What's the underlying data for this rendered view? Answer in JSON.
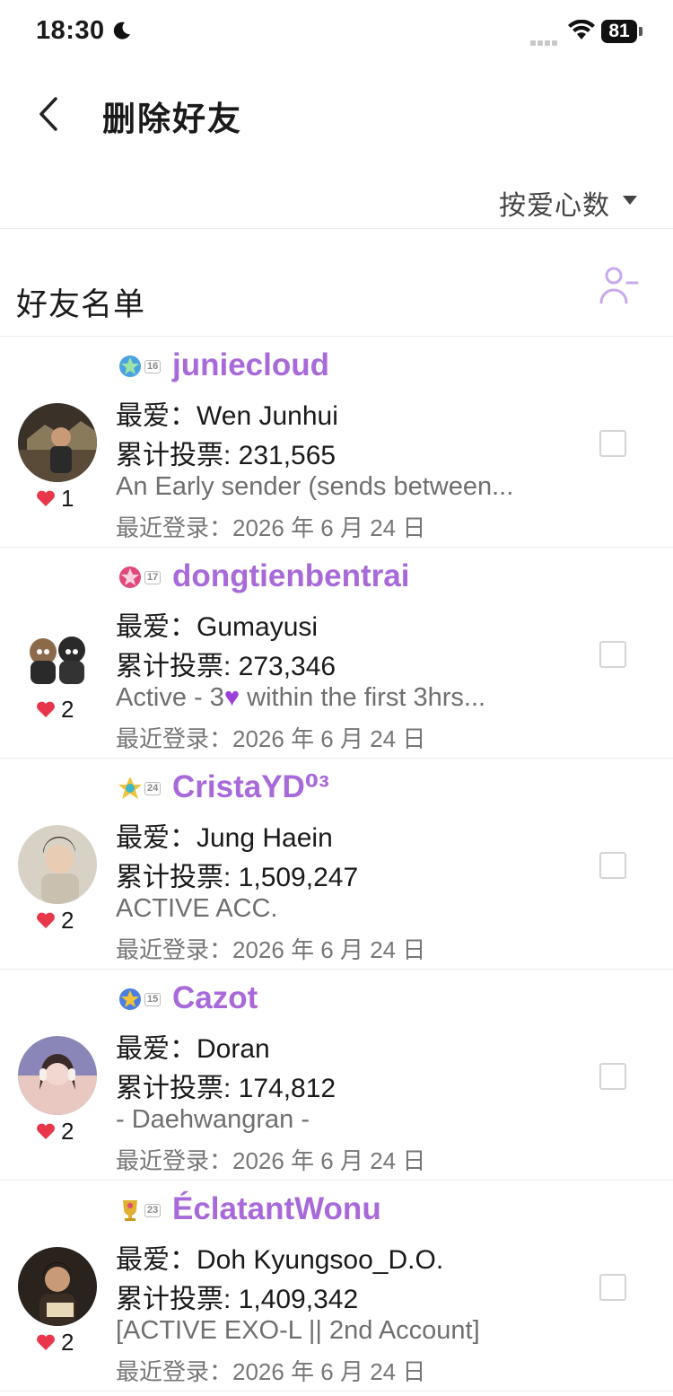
{
  "status_bar": {
    "time": "18:30",
    "battery": "81"
  },
  "nav": {
    "title": "删除好友"
  },
  "sort": {
    "label": "按爱心数"
  },
  "list": {
    "title": "好友名单"
  },
  "friends": [
    {
      "username": "juniecloud",
      "badge_level": "16",
      "badge_color": "#4aa3e0",
      "favorite": "最爱：Wen Junhui",
      "votes": "累计投票: 231,565",
      "bio": "An Early sender (sends between...",
      "last_login": "最近登录：2026 年 6 月 24 日",
      "hearts": "1",
      "avatar_colors": [
        "#3a3228",
        "#8a7a5c"
      ]
    },
    {
      "username": "dongtienbentrai",
      "badge_level": "17",
      "badge_color": "#e0497a",
      "favorite": "最爱：Gumayusi",
      "votes": "累计投票: 273,346",
      "bio_prefix": "Active - 3",
      "bio_suffix": " within the first 3hrs...",
      "last_login": "最近登录：2026 年 6 月 24 日",
      "hearts": "2",
      "avatar_colors": [
        "#ffffff",
        "#2a2a2a"
      ]
    },
    {
      "username": "CristaYD⁰³",
      "badge_level": "24",
      "badge_color": "#3db8c8",
      "favorite": "最爱：Jung Haein",
      "votes": "累计投票: 1,509,247",
      "bio": "ACTIVE ACC.",
      "last_login": "最近登录：2026 年 6 月 24 日",
      "hearts": "2",
      "avatar_colors": [
        "#d8d2c6",
        "#4a4038"
      ]
    },
    {
      "username": "Cazot",
      "badge_level": "15",
      "badge_color": "#4a7fe0",
      "favorite": "最爱：Doran",
      "votes": "累计投票: 174,812",
      "bio": "- Daehwangran -",
      "last_login": "最近登录：2026 年 6 月 24 日",
      "hearts": "2",
      "avatar_colors": [
        "#8a86b8",
        "#f2d6d0"
      ]
    },
    {
      "username": "ÉclatantWonu",
      "badge_level": "23",
      "badge_color": "#e0b030",
      "favorite": "最爱：Doh Kyungsoo_D.O.",
      "votes": "累计投票: 1,409,342",
      "bio": "[ACTIVE EXO-L || 2nd Account]",
      "last_login": "最近登录：2026 年 6 月 24 日",
      "hearts": "2",
      "avatar_colors": [
        "#2a221c",
        "#b89070"
      ]
    }
  ],
  "colors": {
    "accent": "#a869d9",
    "heart": "#e8364a",
    "icon_purple": "#c9a8ec"
  }
}
